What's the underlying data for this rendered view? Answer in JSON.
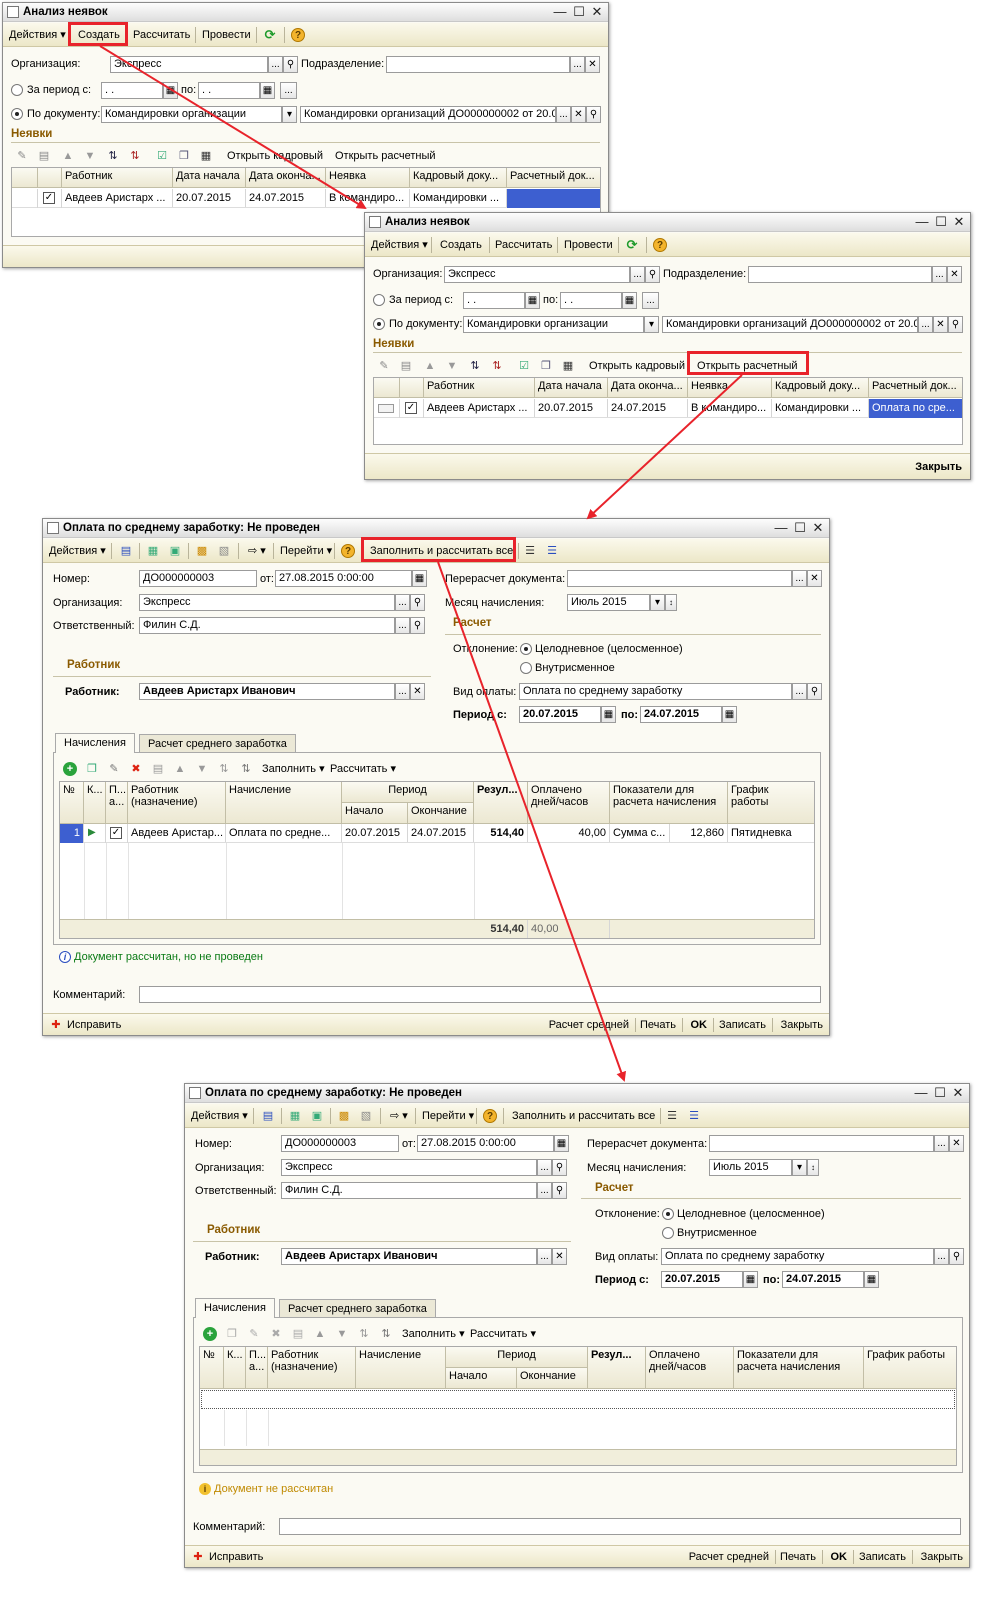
{
  "colors": {
    "accent": "#e8232b",
    "selection": "#3d5fd0",
    "section": "#8a5a00",
    "calc_ok": "#0a7a15",
    "calc_warn": "#c08a00"
  },
  "w1": {
    "title": "Анализ неявок",
    "menu": {
      "actions": "Действия",
      "create": "Создать",
      "calc": "Рассчитать",
      "post": "Провести"
    },
    "org_label": "Организация:",
    "org": "Экспресс",
    "dept_label": "Подразделение:",
    "period_label": "За период с:",
    "date_from": " .  .",
    "to_label": "по:",
    "date_to": " .  .",
    "bydoc_label": "По документу:",
    "doc_type": "Командировки организации",
    "doc": "Командировки организаций ДО000000002 от 20.0",
    "section": "Неявки",
    "open_hr": "Открыть кадровый",
    "open_pay": "Открыть расчетный",
    "cols": [
      "Работник",
      "Дата начала",
      "Дата оконча...",
      "Неявка",
      "Кадровый доку...",
      "Расчетный док..."
    ],
    "row": [
      "Авдеев Аристарх ...",
      "20.07.2015",
      "24.07.2015",
      "В командиро...",
      "Командировки ...",
      ""
    ]
  },
  "w2": {
    "title": "Анализ неявок",
    "menu": {
      "actions": "Действия",
      "create": "Создать",
      "calc": "Рассчитать",
      "post": "Провести"
    },
    "org_label": "Организация:",
    "org": "Экспресс",
    "dept_label": "Подразделение:",
    "period_label": "За период с:",
    "date_from": " .  .",
    "to_label": "по:",
    "date_to": " .  .",
    "bydoc_label": "По документу:",
    "doc_type": "Командировки организации",
    "doc": "Командировки организаций ДО000000002 от 20.0",
    "section": "Неявки",
    "open_hr": "Открыть кадровый",
    "open_pay": "Открыть расчетный",
    "cols": [
      "Работник",
      "Дата начала",
      "Дата оконча...",
      "Неявка",
      "Кадровый доку...",
      "Расчетный док..."
    ],
    "row": [
      "Авдеев Аристарх ...",
      "20.07.2015",
      "24.07.2015",
      "В командиро...",
      "Командировки ...",
      "Оплата по сре..."
    ],
    "close": "Закрыть"
  },
  "w3": {
    "title": "Оплата по среднему заработку: Не проведен",
    "menu": {
      "actions": "Действия",
      "goto": "Перейти",
      "fill_all": "Заполнить и рассчитать все"
    },
    "num_label": "Номер:",
    "num": "ДО000000003",
    "date_label": "от:",
    "date": "27.08.2015  0:00:00",
    "org_label": "Организация:",
    "org": "Экспресс",
    "resp_label": "Ответственный:",
    "resp": "Филин С.Д.",
    "recalc_label": "Перерасчет документа:",
    "month_label": "Месяц начисления:",
    "month": "Июль 2015",
    "calc_section": "Расчет",
    "dev_label": "Отклонение:",
    "dev_full": "Целодневное (целосменное)",
    "dev_intra": "Внутрисменное",
    "worker_section": "Работник",
    "worker_label": "Работник:",
    "worker": "Авдеев Аристарх Иванович",
    "paytype_label": "Вид оплаты:",
    "paytype": "Оплата по среднему заработку",
    "period_label": "Период с:",
    "period_from": "20.07.2015",
    "period_to_label": "по:",
    "period_to": "24.07.2015",
    "tabs": [
      "Начисления",
      "Расчет среднего заработка"
    ],
    "fill": "Заполнить",
    "calc": "Рассчитать",
    "cols": {
      "n": "№",
      "k": "К...",
      "p": "П... а...",
      "worker": "Работник (назначение)",
      "accrual": "Начисление",
      "period": "Период",
      "start": "Начало",
      "end": "Окончание",
      "result": "Резул...",
      "paid": "Оплачено дней/часов",
      "indicators": "Показатели для расчета начисления",
      "schedule": "График работы"
    },
    "row": {
      "n": "1",
      "worker": "Авдеев Аристар...",
      "accrual": "Оплата по средне...",
      "start": "20.07.2015",
      "end": "24.07.2015",
      "result": "514,40",
      "paid": "40,00",
      "ind_name": "Сумма с...",
      "ind_val": "12,860",
      "schedule": "Пятидневка"
    },
    "totals": {
      "result": "514,40",
      "paid": "40,00"
    },
    "status": "Документ рассчитан, но не проведен",
    "comment_label": "Комментарий:",
    "fix": "Исправить",
    "footer": [
      "Расчет средней",
      "Печать",
      "OK",
      "Записать",
      "Закрыть"
    ]
  },
  "w4": {
    "title": "Оплата по среднему заработку: Не проведен",
    "menu": {
      "actions": "Действия",
      "goto": "Перейти",
      "fill_all": "Заполнить и рассчитать все"
    },
    "num_label": "Номер:",
    "num": "ДО000000003",
    "date_label": "от:",
    "date": "27.08.2015  0:00:00",
    "org_label": "Организация:",
    "org": "Экспресс",
    "resp_label": "Ответственный:",
    "resp": "Филин С.Д.",
    "recalc_label": "Перерасчет документа:",
    "month_label": "Месяц начисления:",
    "month": "Июль 2015",
    "calc_section": "Расчет",
    "dev_label": "Отклонение:",
    "dev_full": "Целодневное (целосменное)",
    "dev_intra": "Внутрисменное",
    "worker_section": "Работник",
    "worker_label": "Работник:",
    "worker": "Авдеев Аристарх Иванович",
    "paytype_label": "Вид оплаты:",
    "paytype": "Оплата по среднему заработку",
    "period_label": "Период с:",
    "period_from": "20.07.2015",
    "period_to_label": "по:",
    "period_to": "24.07.2015",
    "tabs": [
      "Начисления",
      "Расчет среднего заработка"
    ],
    "fill": "Заполнить",
    "calc": "Рассчитать",
    "cols": {
      "n": "№",
      "k": "К...",
      "p": "П... а...",
      "worker": "Работник (назначение)",
      "accrual": "Начисление",
      "period": "Период",
      "start": "Начало",
      "end": "Окончание",
      "result": "Резул...",
      "paid": "Оплачено дней/часов",
      "indicators": "Показатели для расчета начисления",
      "schedule": "График работы"
    },
    "status": "Документ не рассчитан",
    "comment_label": "Комментарий:",
    "fix": "Исправить",
    "footer": [
      "Расчет средней",
      "Печать",
      "OK",
      "Записать",
      "Закрыть"
    ]
  }
}
